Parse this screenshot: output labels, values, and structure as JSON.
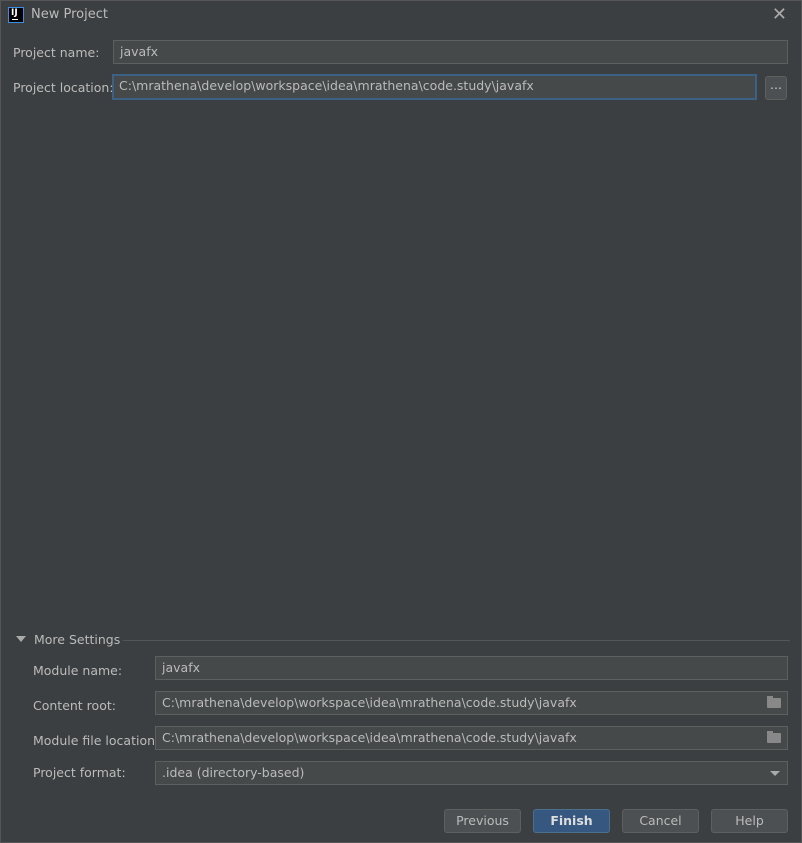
{
  "window": {
    "title": "New Project",
    "app_icon": "intellij-idea-icon",
    "close_icon": "close-icon"
  },
  "project_name": {
    "label": "Project name:",
    "value": "javafx"
  },
  "project_location": {
    "label": "Project location:",
    "value": "C:\\mrathena\\develop\\workspace\\idea\\mrathena\\code.study\\javafx",
    "browse_label": "..."
  },
  "more_settings": {
    "label": "More Settings",
    "expanded": true,
    "module_name": {
      "label": "Module name:",
      "value": "javafx"
    },
    "content_root": {
      "label": "Content root:",
      "value": "C:\\mrathena\\develop\\workspace\\idea\\mrathena\\code.study\\javafx"
    },
    "module_file_location": {
      "label": "Module file location:",
      "value": "C:\\mrathena\\develop\\workspace\\idea\\mrathena\\code.study\\javafx"
    },
    "project_format": {
      "label": "Project format:",
      "value": ".idea (directory-based)"
    }
  },
  "buttons": {
    "previous": "Previous",
    "finish": "Finish",
    "cancel": "Cancel",
    "help": "Help"
  },
  "colors": {
    "background": "#3c3f41",
    "field": "#45494a",
    "primary_button": "#365880",
    "focus_border": "#3d6185"
  }
}
